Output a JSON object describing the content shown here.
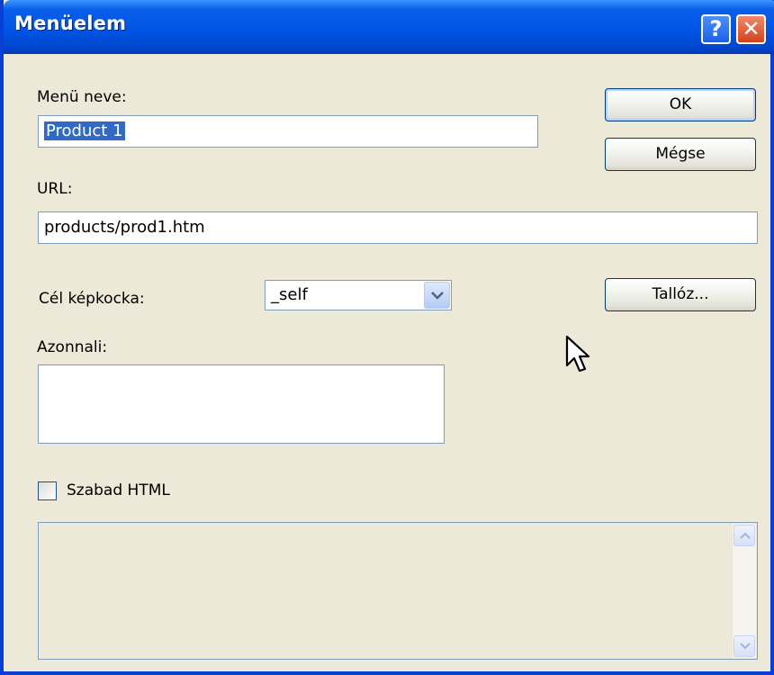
{
  "window": {
    "title": "Menüelem",
    "help_label": "?",
    "close_label": "✕"
  },
  "form": {
    "menu_name_label": "Menü neve:",
    "menu_name_value": "Product 1",
    "url_label": "URL:",
    "url_value": "products/prod1.htm",
    "target_frame_label": "Cél képkocka:",
    "target_frame_value": "_self",
    "instant_label": "Azonnali:",
    "instant_value": "",
    "free_html_label": "Szabad HTML",
    "free_html_checked": false,
    "free_html_value": ""
  },
  "buttons": {
    "ok_label": "OK",
    "cancel_label": "Mégse",
    "browse_label": "Tallóz..."
  },
  "icons": [
    "help-icon",
    "close-icon",
    "chevron-down-icon",
    "scroll-up-arrow-icon",
    "scroll-down-arrow-icon",
    "mouse-pointer-icon"
  ],
  "colors": {
    "titlebar": "#0055e5",
    "dialog_bg": "#ece9d8",
    "selection": "#316ac5",
    "input_border": "#7f9db9"
  }
}
